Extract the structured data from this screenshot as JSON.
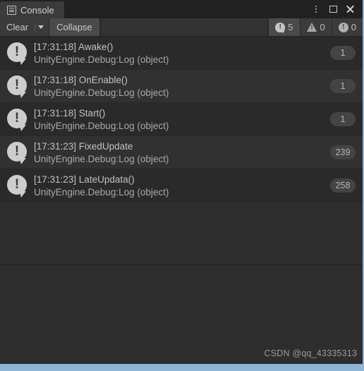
{
  "window": {
    "tab": {
      "label": "Console",
      "icon": "console-lines-icon"
    },
    "controls": {
      "menu": "kebab-menu-icon",
      "maximize": "maximize-icon",
      "close": "close-icon"
    }
  },
  "toolbar": {
    "clear_label": "Clear",
    "clear_dropdown": "chevron-down-icon",
    "collapse_label": "Collapse",
    "search_value": "",
    "counters": [
      {
        "name": "log-counter",
        "icon": "log-bubble-icon",
        "value": "5"
      },
      {
        "name": "warning-counter",
        "icon": "warning-triangle-icon",
        "value": "0"
      },
      {
        "name": "error-counter",
        "icon": "error-circle-icon",
        "value": "0"
      }
    ]
  },
  "log_entries": [
    {
      "icon": "log-bubble-icon",
      "message": "[17:31:18] Awake()",
      "source": "UnityEngine.Debug:Log (object)",
      "count": "1"
    },
    {
      "icon": "log-bubble-icon",
      "message": "[17:31:18] OnEnable()",
      "source": "UnityEngine.Debug:Log (object)",
      "count": "1"
    },
    {
      "icon": "log-bubble-icon",
      "message": "[17:31:18] Start()",
      "source": "UnityEngine.Debug:Log (object)",
      "count": "1"
    },
    {
      "icon": "log-bubble-icon",
      "message": "[17:31:23] FixedUpdate",
      "source": "UnityEngine.Debug:Log (object)",
      "count": "239"
    },
    {
      "icon": "log-bubble-icon",
      "message": "[17:31:23] LateUpdata()",
      "source": "UnityEngine.Debug:Log (object)",
      "count": "258"
    }
  ],
  "detail": {
    "text": "",
    "watermark": "CSDN @qq_43335313"
  },
  "colors": {
    "tabbar_bg": "#212121",
    "toolbar_bg": "#3b3b3b",
    "panel_bg": "#2e2e2e",
    "row_odd": "#2a2a2a",
    "row_even": "#313131",
    "accent_strip": "#8fb6d6",
    "text_primary": "#c2c2c2",
    "text_secondary": "#a9a9a9"
  }
}
